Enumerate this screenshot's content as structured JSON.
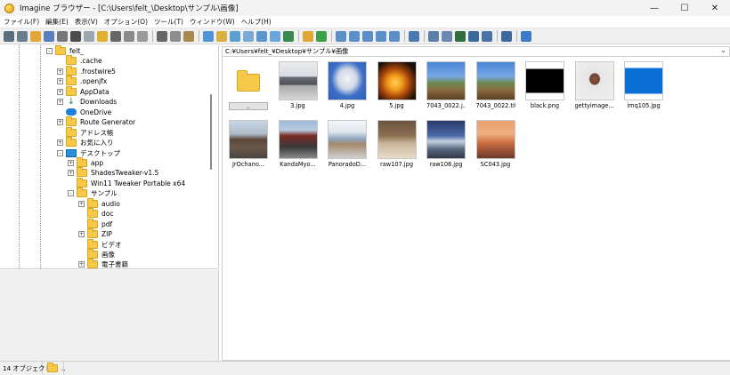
{
  "window": {
    "title": "Imagine ブラウザー - [C:\\Users\\felt_\\Desktop\\サンプル\\画像]",
    "minimize": "—",
    "maximize": "☐",
    "close": "✕"
  },
  "menu": [
    "ファイル(F)",
    "編集(E)",
    "表示(V)",
    "オプション(O)",
    "ツール(T)",
    "ウィンドウ(W)",
    "ヘルプ(H)"
  ],
  "toolbar": {
    "groups": [
      [
        {
          "icon": "eye-icon",
          "color": "#5a6e7f"
        },
        {
          "icon": "refresh-icon",
          "color": "#6b7c8c"
        },
        {
          "icon": "open-folder-icon",
          "color": "#e0a63a"
        },
        {
          "icon": "save-icon",
          "color": "#5a7fbf"
        },
        {
          "icon": "print-icon",
          "color": "#777777"
        },
        {
          "icon": "info-icon",
          "color": "#4d4d4d"
        },
        {
          "icon": "list-icon",
          "color": "#9aa6b2"
        },
        {
          "icon": "new-folder-icon",
          "color": "#e0b030"
        },
        {
          "icon": "cut-icon",
          "color": "#666666"
        },
        {
          "icon": "copy-icon",
          "color": "#8a8a8a"
        },
        {
          "icon": "delete-icon",
          "color": "#9a9a9a"
        }
      ],
      [
        {
          "icon": "scissors-icon",
          "color": "#666666"
        },
        {
          "icon": "copy-file-icon",
          "color": "#8d8d8d"
        },
        {
          "icon": "paste-icon",
          "color": "#a88a50"
        }
      ],
      [
        {
          "icon": "view-mode-icon",
          "color": "#4f93d8"
        },
        {
          "icon": "view-list-icon",
          "color": "#d8b040"
        },
        {
          "icon": "slideshow-icon",
          "color": "#5aa0d0"
        },
        {
          "icon": "thumbnail-icon",
          "color": "#7aaad8"
        },
        {
          "icon": "details-icon",
          "color": "#5e95cc"
        },
        {
          "icon": "preview-icon",
          "color": "#6aa6dd"
        },
        {
          "icon": "image-icon",
          "color": "#3a8a50"
        }
      ],
      [
        {
          "icon": "go-folder-icon",
          "color": "#e0a63a"
        },
        {
          "icon": "sync-icon",
          "color": "#3aa04a"
        }
      ],
      [
        {
          "icon": "layout1-icon",
          "color": "#5c8fc9"
        },
        {
          "icon": "layout2-icon",
          "color": "#5c8fc9"
        },
        {
          "icon": "layout3-icon",
          "color": "#5c8fc9"
        },
        {
          "icon": "layout4-icon",
          "color": "#5c8fc9"
        },
        {
          "icon": "layout5-icon",
          "color": "#5c8fc9"
        }
      ],
      [
        {
          "icon": "pen-icon",
          "color": "#4a7ab0"
        }
      ],
      [
        {
          "icon": "convert-icon",
          "color": "#5a7fa8"
        },
        {
          "icon": "rotate-icon",
          "color": "#6a88b0"
        },
        {
          "icon": "batch-icon",
          "color": "#2f6f3f"
        },
        {
          "icon": "capture-icon",
          "color": "#3a6a9a"
        },
        {
          "icon": "edit-icon",
          "color": "#4a74a8"
        }
      ],
      [
        {
          "icon": "export-icon",
          "color": "#3d6aa0"
        }
      ],
      [
        {
          "icon": "help-icon",
          "color": "#3f7ac8"
        }
      ]
    ]
  },
  "tree": {
    "items": [
      {
        "label": "felt_",
        "level": 0,
        "exp": "-",
        "icon": "folder"
      },
      {
        "label": ".cache",
        "level": 1,
        "exp": "",
        "icon": "folder"
      },
      {
        "label": ".frostwire5",
        "level": 1,
        "exp": "+",
        "icon": "folder"
      },
      {
        "label": ".openjfx",
        "level": 1,
        "exp": "+",
        "icon": "folder"
      },
      {
        "label": "AppData",
        "level": 1,
        "exp": "+",
        "icon": "folder"
      },
      {
        "label": "Downloads",
        "level": 1,
        "exp": "+",
        "icon": "download"
      },
      {
        "label": "OneDrive",
        "level": 1,
        "exp": "",
        "icon": "cloud"
      },
      {
        "label": "Route Generator",
        "level": 1,
        "exp": "+",
        "icon": "folder"
      },
      {
        "label": "アドレス帳",
        "level": 1,
        "exp": "",
        "icon": "folder"
      },
      {
        "label": "お気に入り",
        "level": 1,
        "exp": "+",
        "icon": "folder"
      },
      {
        "label": "デスクトップ",
        "level": 1,
        "exp": "-",
        "icon": "desktop"
      },
      {
        "label": "app",
        "level": 2,
        "exp": "+",
        "icon": "folder"
      },
      {
        "label": "ShadesTweaker-v1.5",
        "level": 2,
        "exp": "+",
        "icon": "folder"
      },
      {
        "label": "Win11 Tweaker Portable x64",
        "level": 2,
        "exp": "",
        "icon": "folder"
      },
      {
        "label": "サンプル",
        "level": 2,
        "exp": "-",
        "icon": "folder"
      },
      {
        "label": "audio",
        "level": 3,
        "exp": "+",
        "icon": "folder"
      },
      {
        "label": "doc",
        "level": 3,
        "exp": "",
        "icon": "folder"
      },
      {
        "label": "pdf",
        "level": 3,
        "exp": "",
        "icon": "folder"
      },
      {
        "label": "ZIP",
        "level": 3,
        "exp": "+",
        "icon": "folder"
      },
      {
        "label": "ビデオ",
        "level": 3,
        "exp": "",
        "icon": "folder"
      },
      {
        "label": "画像",
        "level": 3,
        "exp": "",
        "icon": "folder"
      },
      {
        "label": "電子書籍",
        "level": 3,
        "exp": "+",
        "icon": "folder"
      }
    ]
  },
  "path_bar": {
    "path": "C:¥Users¥felt_¥Desktop¥サンプル¥画像",
    "dropdown": "⌄"
  },
  "thumbnails": [
    {
      "label": "..",
      "kind": "folder",
      "selected": true
    },
    {
      "label": "3.jpg",
      "kind": "photo",
      "bg": "linear-gradient(#e9ecef 0%,#d9dde2 38%,#6c7077 40%,#4c4f55 60%,#a9a9a9 62%,#d6d6d6 100%)"
    },
    {
      "label": "4.jpg",
      "kind": "photo",
      "bg": "radial-gradient(ellipse at 50% 45%,#f2f4f8 0%,#cfd8e6 35%,#3f70c8 60%,#2c5fb8 100%)"
    },
    {
      "label": "5.jpg",
      "kind": "photo",
      "bg": "radial-gradient(circle at 45% 55%,#ffd257 0%,#f29a1a 25%,#a2430d 50%,#1a0f08 80%)"
    },
    {
      "label": "7043_0022.j...",
      "kind": "photo",
      "bg": "linear-gradient(#4a86d6 0%,#78a8e4 38%,#6b8a52 55%,#8a6a3e 75%,#5a4026 100%)"
    },
    {
      "label": "7043_0022.tif",
      "kind": "photo",
      "bg": "linear-gradient(#4a86d6 0%,#78a8e4 38%,#6b8a52 55%,#8a6a3e 75%,#5a4026 100%)"
    },
    {
      "label": "black.png",
      "kind": "photo",
      "bg": "linear-gradient(#ffffff 0%,#ffffff 18%,#000000 18%,#000000 82%,#ffffff 82%)"
    },
    {
      "label": "gettyimage...",
      "kind": "photo",
      "bg": "radial-gradient(ellipse at 50% 45%,#8a5a3c 0%,#6b4030 18%,#e6e6e6 22%,#f0f0f0 100%)"
    },
    {
      "label": "imq105.jpg",
      "kind": "photo",
      "bg": "linear-gradient(#ffffff 0%,#ffffff 16%,#0a6fd6 16%,#0a6fd6 84%,#ffffff 84%)"
    },
    {
      "label": "JrOchano...",
      "kind": "photo",
      "bg": "linear-gradient(#c9d6e6 0%,#aebbc8 35%,#5a4638 50%,#6a5a4c 70%,#4a4440 100%)"
    },
    {
      "label": "KandaMyo...",
      "kind": "photo",
      "bg": "linear-gradient(#9fb9d9 0%,#b8cbe0 25%,#7a2a22 40%,#3a3a3a 70%,#8a8a8a 100%)"
    },
    {
      "label": "PanoradoD...",
      "kind": "photo",
      "bg": "linear-gradient(#f4f6f8 0%,#dfe6ee 30%,#8fa6bf 48%,#a48a6c 62%,#cfcfcf 100%)"
    },
    {
      "label": "raw107.jpg",
      "kind": "photo",
      "bg": "linear-gradient(#6a5440 0%,#8c7052 40%,#c9b59a 60%,#e8dcc8 100%)"
    },
    {
      "label": "raw108.jpg",
      "kind": "photo",
      "bg": "linear-gradient(#2a3a6a 0%,#4a6aa8 40%,#c6d2e2 55%,#5a6a80 75%,#303848 100%)"
    },
    {
      "label": "SC043.jpg",
      "kind": "photo",
      "bg": "linear-gradient(#e8a070 0%,#f0b080 35%,#c86a40 60%,#6a3a2a 100%)"
    }
  ],
  "status": {
    "count": "14 オブジェクト",
    "folder_label": ".."
  }
}
